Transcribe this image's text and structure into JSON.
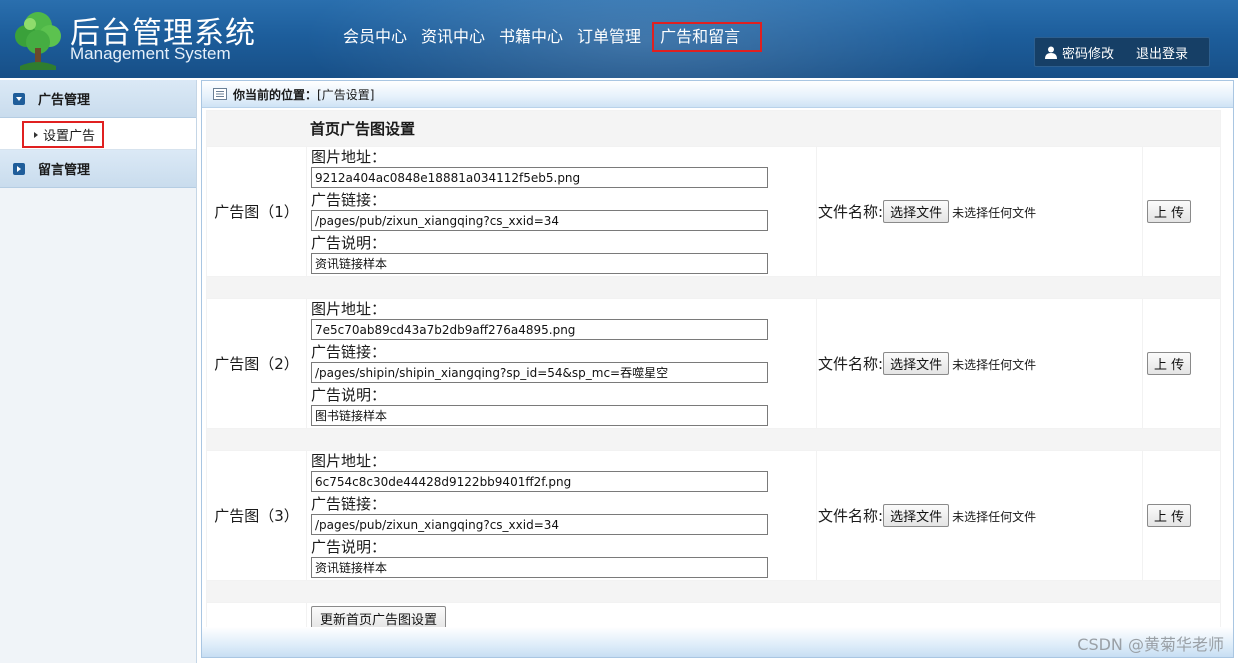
{
  "header": {
    "brand_title": "后台管理系统",
    "brand_subtitle": "Management System",
    "nav": [
      {
        "label": "会员中心"
      },
      {
        "label": "资讯中心"
      },
      {
        "label": "书籍中心"
      },
      {
        "label": "订单管理"
      },
      {
        "label": "广告和留言"
      }
    ],
    "user_links": {
      "change_password": "密码修改",
      "logout": "退出登录"
    }
  },
  "sidebar": {
    "groups": [
      {
        "label": "广告管理",
        "expanded": true,
        "items": [
          {
            "label": "设置广告"
          }
        ]
      },
      {
        "label": "留言管理",
        "expanded": false
      }
    ]
  },
  "main": {
    "breadcrumb": {
      "label": "你当前的位置：",
      "value": "[广告设置]"
    },
    "section_title": "首页广告图设置",
    "field_labels": {
      "image_url": "图片地址：",
      "ad_link": "广告链接：",
      "ad_desc": "广告说明："
    },
    "file_label": "文件名称:",
    "choose_file": "选择文件",
    "no_file": "未选择任何文件",
    "upload": "上 传",
    "ads": [
      {
        "label": "广告图（1）",
        "image_url": "9212a404ac0848e18881a034112f5eb5.png",
        "ad_link": "/pages/pub/zixun_xiangqing?cs_xxid=34",
        "ad_desc": "资讯链接样本"
      },
      {
        "label": "广告图（2）",
        "image_url": "7e5c70ab89cd43a7b2db9aff276a4895.png",
        "ad_link": "/pages/shipin/shipin_xiangqing?sp_id=54&sp_mc=吞噬星空",
        "ad_desc": "图书链接样本"
      },
      {
        "label": "广告图（3）",
        "image_url": "6c754c8c30de44428d9122bb9401ff2f.png",
        "ad_link": "/pages/pub/zixun_xiangqing?cs_xxid=34",
        "ad_desc": "资讯链接样本"
      }
    ],
    "submit": "更新首页广告图设置"
  },
  "watermark": "CSDN @黄菊华老师",
  "colors": {
    "header": "#1d5e9c",
    "highlight_border": "#e02020",
    "sidebar_group": "#c9dced"
  }
}
